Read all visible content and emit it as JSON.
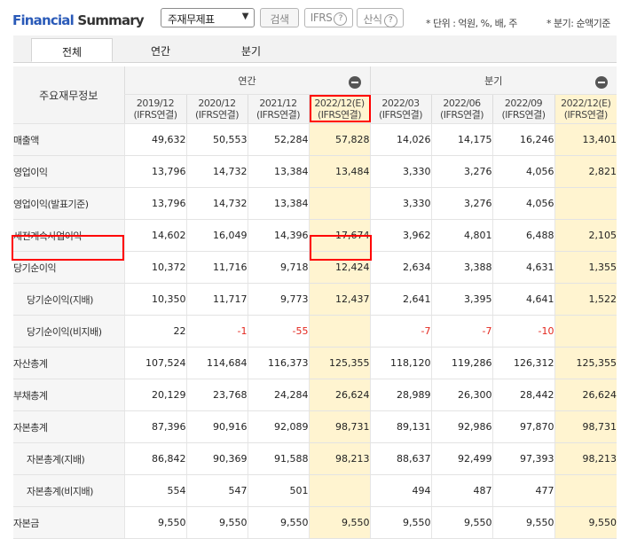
{
  "header": {
    "brand_part1": "Financial",
    "brand_part2": "Summary",
    "statement_select": "주재무제표",
    "search_button": "검색",
    "ifrs_button": "IFRS",
    "formula_button": "산식",
    "unit_note": "* 단위 : 억원, %, 배, 주",
    "quarter_note": "* 분기: 순액기준"
  },
  "tabs": [
    "전체",
    "연간",
    "분기"
  ],
  "table": {
    "corner_label": "주요재무정보",
    "annual_group": "연간",
    "quarter_group": "분기",
    "periods": [
      {
        "date": "2019/12",
        "basis": "(IFRS연결)"
      },
      {
        "date": "2020/12",
        "basis": "(IFRS연결)"
      },
      {
        "date": "2021/12",
        "basis": "(IFRS연결)"
      },
      {
        "date": "2022/12(E)",
        "basis": "(IFRS연결)"
      },
      {
        "date": "2022/03",
        "basis": "(IFRS연결)"
      },
      {
        "date": "2022/06",
        "basis": "(IFRS연결)"
      },
      {
        "date": "2022/09",
        "basis": "(IFRS연결)"
      },
      {
        "date": "2022/12(E)",
        "basis": "(IFRS연결)"
      }
    ],
    "rows": [
      {
        "label": "매출액",
        "sub": false,
        "values": [
          "49,632",
          "50,553",
          "52,284",
          "57,828",
          "14,026",
          "14,175",
          "16,246",
          "13,401"
        ]
      },
      {
        "label": "영업이익",
        "sub": false,
        "values": [
          "13,796",
          "14,732",
          "13,384",
          "13,484",
          "3,330",
          "3,276",
          "4,056",
          "2,821"
        ]
      },
      {
        "label": "영업이익(발표기준)",
        "sub": false,
        "values": [
          "13,796",
          "14,732",
          "13,384",
          "",
          "3,330",
          "3,276",
          "4,056",
          ""
        ]
      },
      {
        "label": "세전계속사업이익",
        "sub": false,
        "values": [
          "14,602",
          "16,049",
          "14,396",
          "17,674",
          "3,962",
          "4,801",
          "6,488",
          "2,105"
        ]
      },
      {
        "label": "당기순이익",
        "sub": false,
        "values": [
          "10,372",
          "11,716",
          "9,718",
          "12,424",
          "2,634",
          "3,388",
          "4,631",
          "1,355"
        ]
      },
      {
        "label": "당기순이익(지배)",
        "sub": true,
        "values": [
          "10,350",
          "11,717",
          "9,773",
          "12,437",
          "2,641",
          "3,395",
          "4,641",
          "1,522"
        ]
      },
      {
        "label": "당기순이익(비지배)",
        "sub": true,
        "values": [
          "22",
          "-1",
          "-55",
          "",
          "-7",
          "-7",
          "-10",
          ""
        ]
      },
      {
        "label": "자산총계",
        "sub": false,
        "values": [
          "107,524",
          "114,684",
          "116,373",
          "125,355",
          "118,120",
          "119,286",
          "126,312",
          "125,355"
        ]
      },
      {
        "label": "부채총계",
        "sub": false,
        "values": [
          "20,129",
          "23,768",
          "24,284",
          "26,624",
          "28,989",
          "26,300",
          "28,442",
          "26,624"
        ]
      },
      {
        "label": "자본총계",
        "sub": false,
        "values": [
          "87,396",
          "90,916",
          "92,089",
          "98,731",
          "89,131",
          "92,986",
          "97,870",
          "98,731"
        ]
      },
      {
        "label": "자본총계(지배)",
        "sub": true,
        "values": [
          "86,842",
          "90,369",
          "91,588",
          "98,213",
          "88,637",
          "92,499",
          "97,393",
          "98,213"
        ]
      },
      {
        "label": "자본총계(비지배)",
        "sub": true,
        "values": [
          "554",
          "547",
          "501",
          "",
          "494",
          "487",
          "477",
          ""
        ]
      },
      {
        "label": "자본금",
        "sub": false,
        "values": [
          "9,550",
          "9,550",
          "9,550",
          "9,550",
          "9,550",
          "9,550",
          "9,550",
          "9,550"
        ]
      }
    ]
  },
  "colors": {
    "brand_blue": "#2a5ab8",
    "estimate_bg": "#fff4d0",
    "negative": "#e3261d",
    "highlight_box": "#ff0000"
  }
}
